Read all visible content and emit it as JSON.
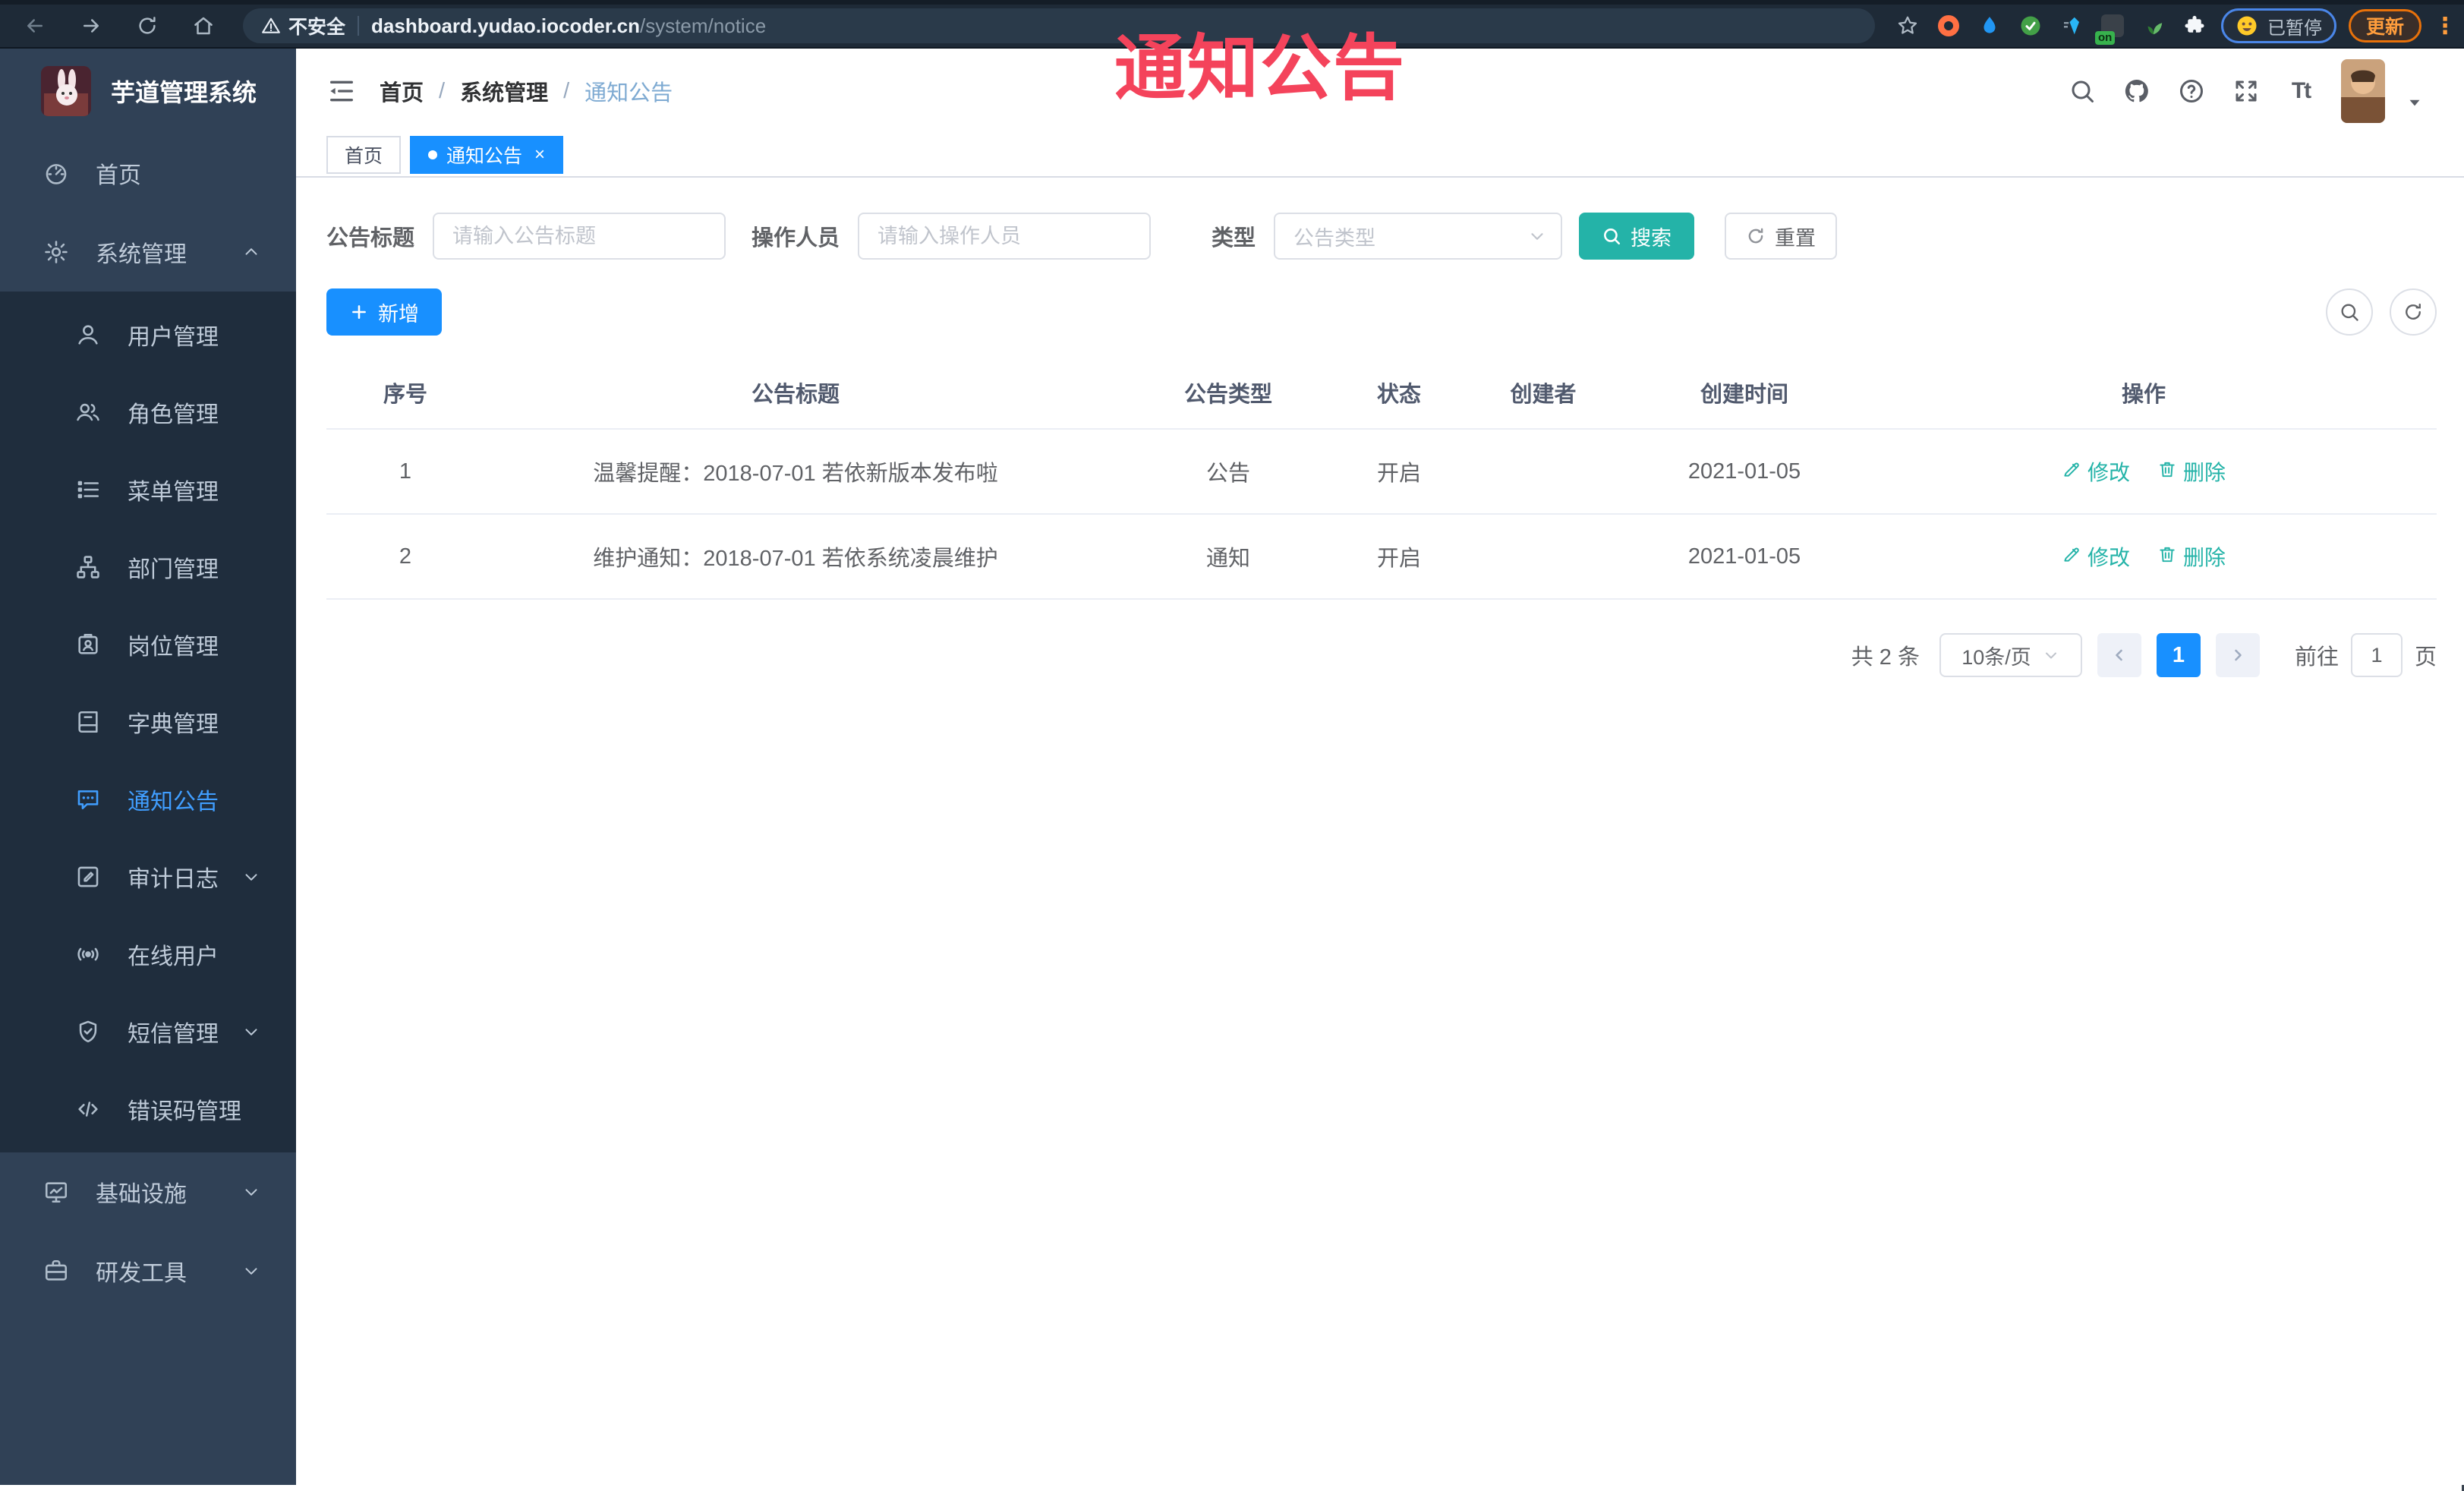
{
  "browser": {
    "security_warning": "不安全",
    "url_host": "dashboard.yudao.iocoder.cn",
    "url_path": "/system/notice",
    "extension_on_badge": "on",
    "paused_badge": "已暂停",
    "update_button": "更新"
  },
  "overlay": {
    "title": "通知公告",
    "color": "#f4435b"
  },
  "sidebar": {
    "logo_title": "芋道管理系统",
    "items": [
      {
        "icon": "dashboard",
        "label": "首页",
        "level": 1
      },
      {
        "icon": "gear",
        "label": "系统管理",
        "level": 1,
        "arrow": "up"
      },
      {
        "icon": "user",
        "label": "用户管理",
        "level": 2
      },
      {
        "icon": "users",
        "label": "角色管理",
        "level": 2
      },
      {
        "icon": "menulist",
        "label": "菜单管理",
        "level": 2
      },
      {
        "icon": "orgtree",
        "label": "部门管理",
        "level": 2
      },
      {
        "icon": "badge",
        "label": "岗位管理",
        "level": 2
      },
      {
        "icon": "book",
        "label": "字典管理",
        "level": 2
      },
      {
        "icon": "message",
        "label": "通知公告",
        "level": 2,
        "active": true
      },
      {
        "icon": "log",
        "label": "审计日志",
        "level": 2,
        "arrow": "down"
      },
      {
        "icon": "online",
        "label": "在线用户",
        "level": 2
      },
      {
        "icon": "shield",
        "label": "短信管理",
        "level": 2,
        "arrow": "down"
      },
      {
        "icon": "code",
        "label": "错误码管理",
        "level": 2
      },
      {
        "icon": "chart",
        "label": "基础设施",
        "level": 1,
        "arrow": "down"
      },
      {
        "icon": "tool",
        "label": "研发工具",
        "level": 1,
        "arrow": "down"
      }
    ]
  },
  "breadcrumb": [
    "首页",
    "系统管理",
    "通知公告"
  ],
  "tabs": [
    {
      "label": "首页",
      "active": false,
      "closable": false
    },
    {
      "label": "通知公告",
      "active": true,
      "closable": true
    }
  ],
  "filters": {
    "title_label": "公告标题",
    "title_placeholder": "请输入公告标题",
    "operator_label": "操作人员",
    "operator_placeholder": "请输入操作人员",
    "type_label": "类型",
    "type_placeholder": "公告类型",
    "search_label": "搜索",
    "reset_label": "重置"
  },
  "toolbar": {
    "add_label": "新增"
  },
  "table": {
    "columns": [
      "序号",
      "公告标题",
      "公告类型",
      "状态",
      "创建者",
      "创建时间",
      "操作"
    ],
    "rows": [
      {
        "index": "1",
        "title": "温馨提醒：2018-07-01 若依新版本发布啦",
        "type": "公告",
        "status": "开启",
        "creator": "",
        "create_time": "2021-01-05"
      },
      {
        "index": "2",
        "title": "维护通知：2018-07-01 若依系统凌晨维护",
        "type": "通知",
        "status": "开启",
        "creator": "",
        "create_time": "2021-01-05"
      }
    ],
    "edit_label": "修改",
    "delete_label": "删除"
  },
  "pagination": {
    "total_text": "共 2 条",
    "page_size": "10条/页",
    "current_page": "1",
    "goto_label": "前往",
    "goto_value": "1",
    "page_unit": "页"
  },
  "colors": {
    "primary_blue": "#1890ff",
    "teal_action": "#24b3a8",
    "sidebar_bg": "#304156",
    "submenu_bg": "#1f2d3d",
    "active_menu": "#409eff",
    "annotation_red": "#f4435b"
  }
}
